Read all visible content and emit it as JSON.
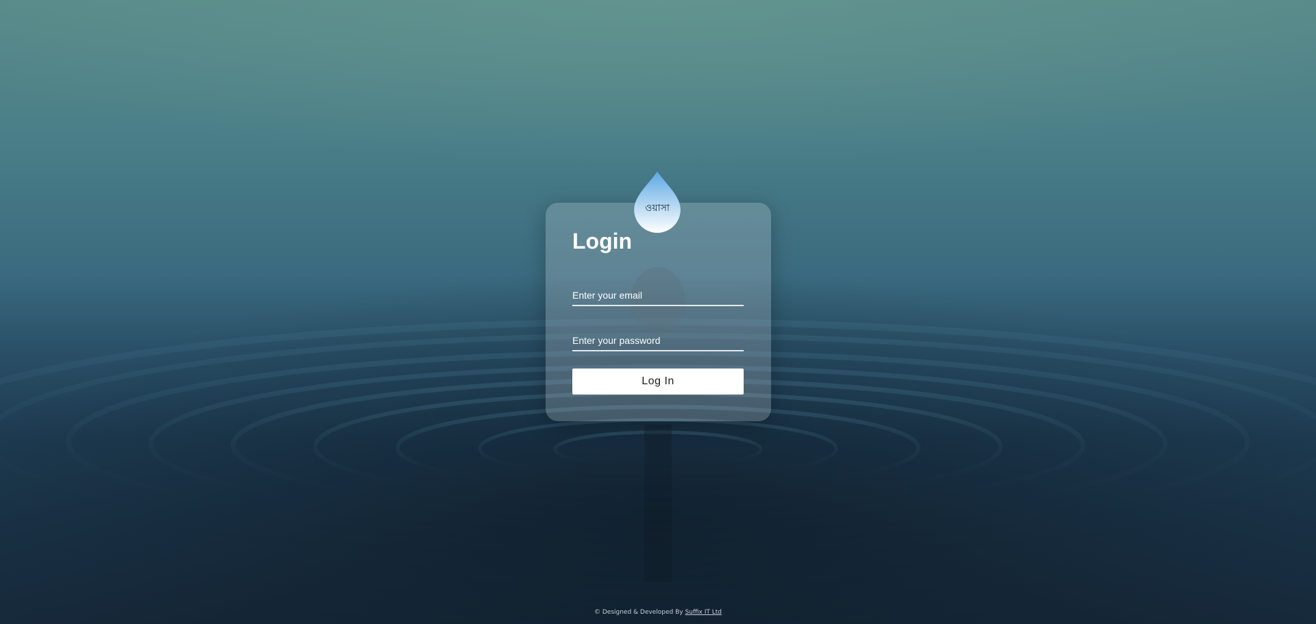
{
  "logo": {
    "text": "ওয়াসা"
  },
  "login_form": {
    "title": "Login",
    "email_placeholder": "Enter your email",
    "email_value": "",
    "password_placeholder": "Enter your password",
    "password_value": "",
    "submit_label": "Log In"
  },
  "footer": {
    "prefix": "© Designed & Developed By ",
    "link_text": "Suffix IT Ltd"
  },
  "colors": {
    "card_background": "rgba(190,200,210,0.28)",
    "button_background": "#ffffff",
    "drop_top": "#5aa8e4",
    "drop_bottom": "#ffffff"
  },
  "icons": {
    "logo": "water-drop-icon"
  }
}
